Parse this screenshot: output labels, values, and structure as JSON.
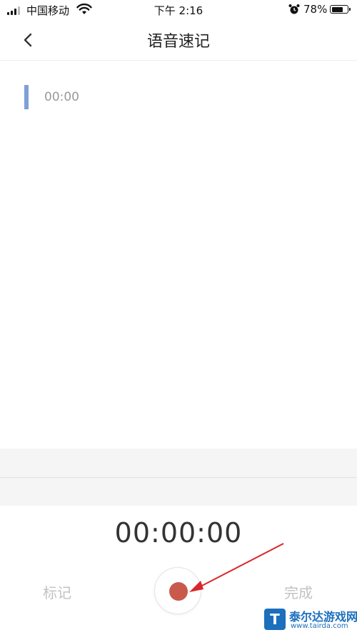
{
  "status_bar": {
    "carrier": "中国移动",
    "time": "下午 2:16",
    "battery_percent": "78%",
    "battery_level": 0.78,
    "icons": [
      "signal-icon",
      "wifi-icon",
      "alarm-icon",
      "battery-icon"
    ]
  },
  "nav": {
    "back_icon": "chevron-left-icon",
    "title": "语音速记"
  },
  "markers": [
    {
      "time": "00:00"
    }
  ],
  "recorder": {
    "timer": "00:00:00",
    "mark_label": "标记",
    "done_label": "完成",
    "record_icon": "record-icon"
  },
  "colors": {
    "record_dot": "#c9594a",
    "marker_bar": "#7f9fd8",
    "annotation_arrow": "#d9262a",
    "watermark_blue": "#1b6fbd"
  },
  "watermark": {
    "logo_letter": "T",
    "name": "泰尔达游戏网",
    "url": "www.tairda.com"
  }
}
